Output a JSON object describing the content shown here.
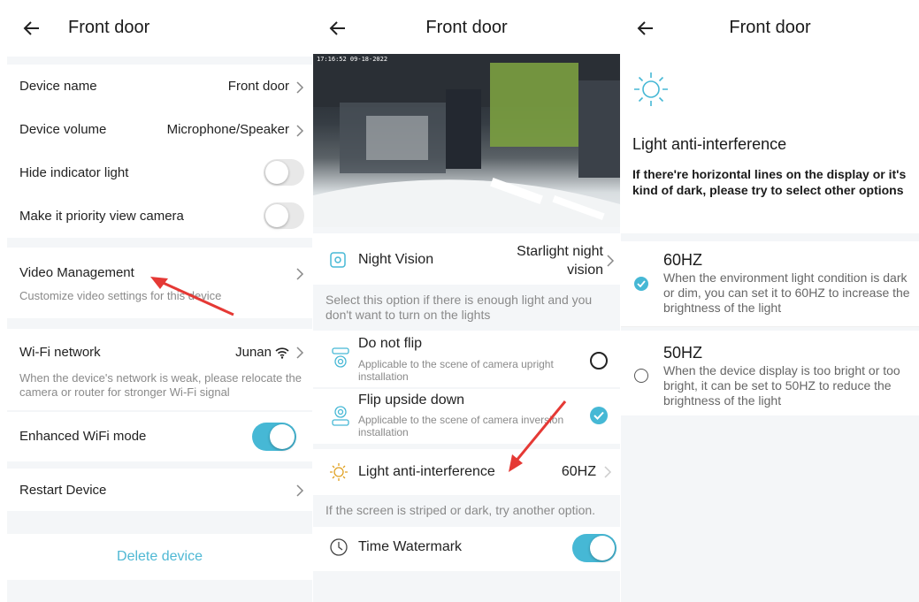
{
  "colors": {
    "accent": "#46b8d5",
    "arrow": "#e53935",
    "delete": "#4fb8d4"
  },
  "panel1": {
    "title": "Front door",
    "device_name_label": "Device name",
    "device_name_value": "Front door",
    "device_volume_label": "Device volume",
    "device_volume_value": "Microphone/Speaker",
    "hide_indicator_label": "Hide indicator light",
    "hide_indicator_on": false,
    "priority_view_label": "Make it priority view camera",
    "priority_view_on": false,
    "video_mgmt_label": "Video Management",
    "video_mgmt_sub": "Customize video settings for this device",
    "wifi_label": "Wi-Fi network",
    "wifi_value": "Junan",
    "wifi_sub": "When the device's network is weak, please relocate the camera or router for stronger Wi-Fi signal",
    "enhanced_wifi_label": "Enhanced WiFi mode",
    "enhanced_wifi_on": true,
    "restart_label": "Restart Device",
    "delete_label": "Delete device"
  },
  "panel2": {
    "title": "Front door",
    "video_timestamp": "17:16:52 09-18-2022",
    "night_vision_label": "Night Vision",
    "night_vision_value": "Starlight night vision",
    "night_vision_value_line1": "Starlight night",
    "night_vision_value_line2": "vision",
    "night_vision_note": "Select this option if there is enough light and you don't want to turn on the lights",
    "no_flip_title": "Do not flip",
    "no_flip_sub": "Applicable to the scene of camera upright installation",
    "flip_title": "Flip upside down",
    "flip_sub": "Applicable to the scene of camera inversion installation",
    "light_label": "Light anti-interference",
    "light_value": "60HZ",
    "light_note": "If the screen is striped or dark, try another option.",
    "watermark_label": "Time Watermark",
    "watermark_on": true
  },
  "panel3": {
    "title": "Front door",
    "heading": "Light anti-interference",
    "desc": "If there're horizontal lines on the display or it's kind of dark, please try to select other options",
    "opt1_title": "60HZ",
    "opt1_desc": "When the environment light condition is dark or dim, you can set it to 60HZ to increase the brightness of the light",
    "opt1_selected": true,
    "opt2_title": "50HZ",
    "opt2_desc": "When the device display is too bright or too bright, it can be set to 50HZ to reduce the brightness of the light",
    "opt2_selected": false
  }
}
